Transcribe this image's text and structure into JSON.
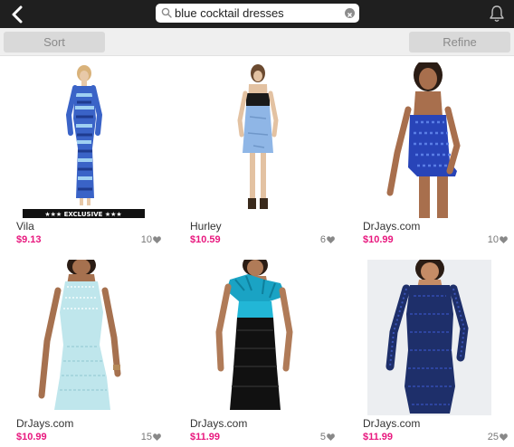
{
  "search": {
    "value": "blue cocktail dresses"
  },
  "toolbar": {
    "sort_label": "Sort",
    "refine_label": "Refine"
  },
  "products": [
    {
      "brand": "Vila",
      "price": "$9.13",
      "likes": "10",
      "badge": "★★★ EXCLUSIVE ★★★"
    },
    {
      "brand": "Hurley",
      "price": "$10.59",
      "likes": "6"
    },
    {
      "brand": "DrJays.com",
      "price": "$10.99",
      "likes": "10"
    },
    {
      "brand": "DrJays.com",
      "price": "$10.99",
      "likes": "15"
    },
    {
      "brand": "DrJays.com",
      "price": "$11.99",
      "likes": "5"
    },
    {
      "brand": "DrJays.com",
      "price": "$11.99",
      "likes": "25"
    }
  ],
  "colors": {
    "price": "#e8177e",
    "topbar": "#1f1f1f"
  }
}
